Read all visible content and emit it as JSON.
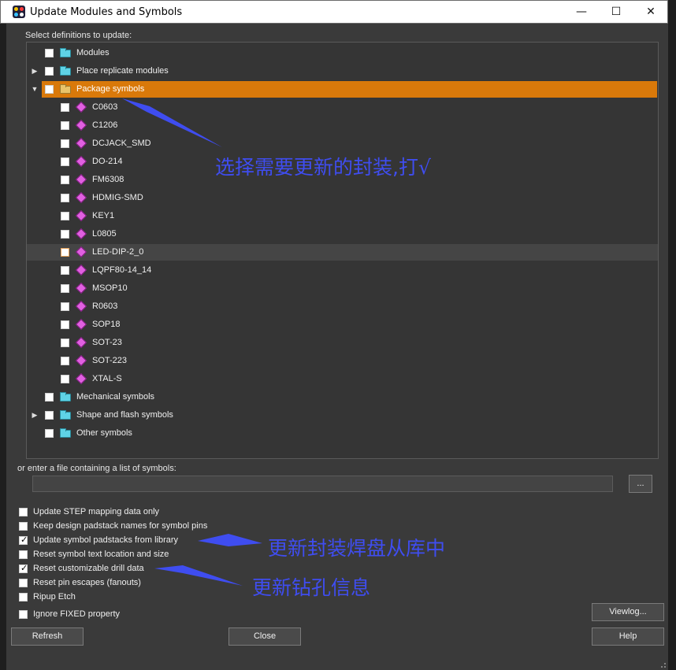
{
  "window": {
    "title": "Update Modules and Symbols",
    "minimize_glyph": "—",
    "maximize_glyph": "☐",
    "close_glyph": "✕"
  },
  "tree": {
    "header": "Select definitions to update:",
    "groups": [
      {
        "label": "Modules",
        "expandable": false,
        "expanded": false
      },
      {
        "label": "Place replicate modules",
        "expandable": true,
        "expanded": false
      },
      {
        "label": "Package symbols",
        "expandable": true,
        "expanded": true,
        "selected": true,
        "children": [
          "C0603",
          "C1206",
          "DCJACK_SMD",
          "DO-214",
          "FM6308",
          "HDMIG-SMD",
          "KEY1",
          "L0805",
          "LED-DIP-2_0",
          "LQPF80-14_14",
          "MSOP10",
          "R0603",
          "SOP18",
          "SOT-23",
          "SOT-223",
          "XTAL-S"
        ],
        "hovered_child": "LED-DIP-2_0"
      },
      {
        "label": "Mechanical symbols",
        "expandable": false,
        "expanded": false
      },
      {
        "label": "Shape and flash symbols",
        "expandable": true,
        "expanded": false
      },
      {
        "label": "Other symbols",
        "expandable": false,
        "expanded": false
      }
    ]
  },
  "file_list": {
    "label": "or enter a file containing a list of symbols:",
    "value": "",
    "browse_label": "..."
  },
  "options": [
    {
      "label": "Update STEP mapping data only",
      "checked": false
    },
    {
      "label": "Keep design padstack names for symbol pins",
      "checked": false
    },
    {
      "label": "Update symbol padstacks from library",
      "checked": true
    },
    {
      "label": "Reset symbol text location and size",
      "checked": false
    },
    {
      "label": "Reset customizable drill data",
      "checked": true
    },
    {
      "label": "Reset pin escapes (fanouts)",
      "checked": false
    },
    {
      "label": "Ripup Etch",
      "checked": false
    },
    {
      "label": "Ignore FIXED property",
      "checked": false
    }
  ],
  "buttons": {
    "viewlog": "Viewlog...",
    "refresh": "Refresh",
    "close": "Close",
    "help": "Help"
  },
  "annotations": {
    "select_packages": "选择需要更新的封装,打√",
    "update_padstacks": "更新封装焊盘从库中",
    "update_drill": "更新钻孔信息",
    "color": "#3f4df0"
  },
  "colors": {
    "selection": "#d9790a",
    "dialog_bg": "#3a3a3a",
    "tree_bg": "#353535",
    "package_icon": "#e060e0",
    "folder_icon": "#5fd3e6"
  }
}
